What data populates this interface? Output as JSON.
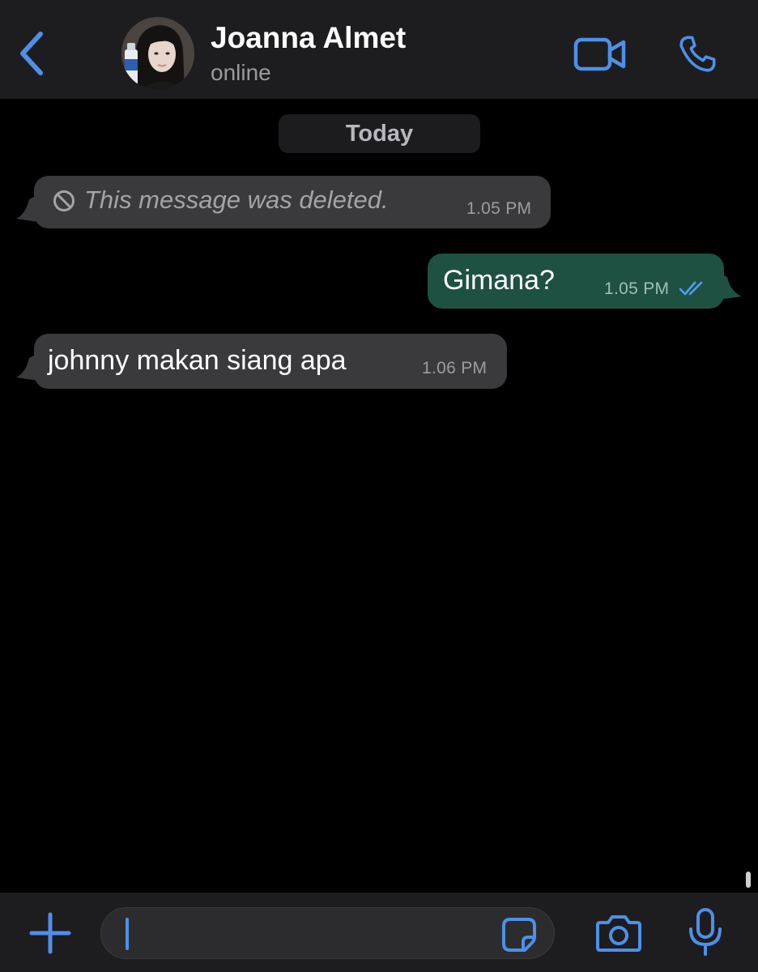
{
  "header": {
    "contact_name": "Joanna Almet",
    "status": "online",
    "accent_color": "#4f8fe8"
  },
  "chat": {
    "date_separator": "Today",
    "messages": [
      {
        "direction": "incoming",
        "deleted": true,
        "text": "This message was deleted.",
        "time": "1.05 PM",
        "icon": "blocked-icon"
      },
      {
        "direction": "outgoing",
        "deleted": false,
        "text": "Gimana?",
        "time": "1.05 PM",
        "status": "read",
        "icon": "double-check-icon"
      },
      {
        "direction": "incoming",
        "deleted": false,
        "text": "johnny makan siang apa",
        "time": "1.06 PM"
      }
    ]
  },
  "composer": {
    "value": "",
    "icons": [
      "plus-icon",
      "sticker-icon",
      "camera-icon",
      "microphone-icon"
    ]
  },
  "colors": {
    "incoming_bubble": "#3a3a3c",
    "outgoing_bubble": "#1f5143",
    "header_bg": "#1d1d1f",
    "read_check": "#4f9df0"
  }
}
